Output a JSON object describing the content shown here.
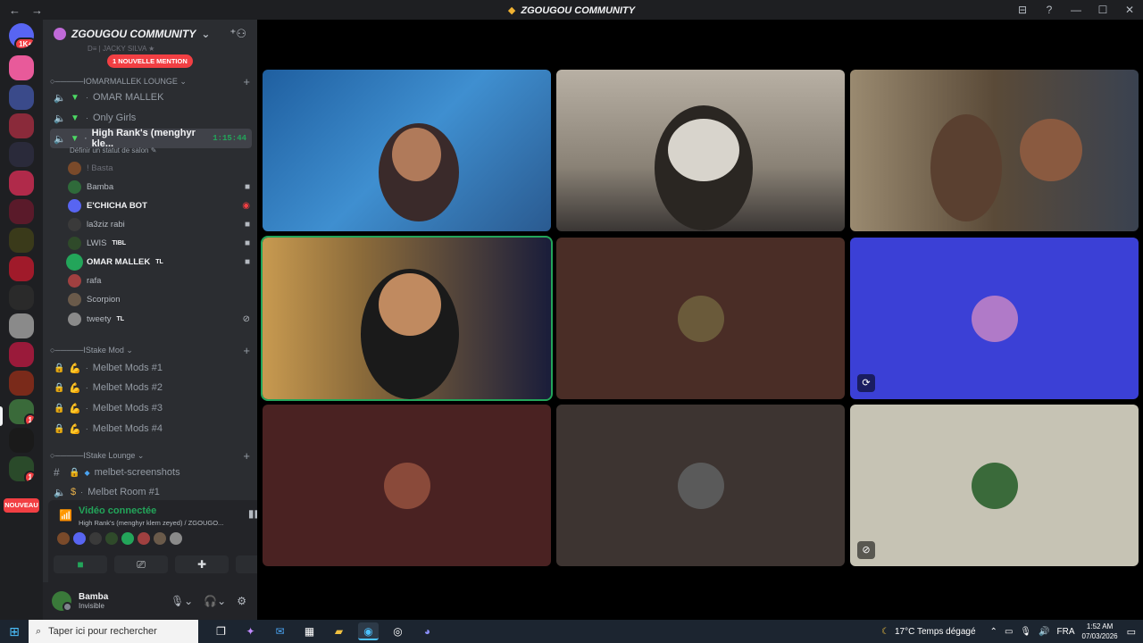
{
  "window": {
    "title": "ZGOUGOU COMMUNITY",
    "back_icon": "←",
    "forward_icon": "→",
    "controls": [
      "⊟",
      "?",
      "—",
      "☐",
      "✕"
    ]
  },
  "rail": {
    "home_badge": "1K+",
    "new_badge": "NOUVEAU",
    "server_badges": [
      "1",
      "1"
    ]
  },
  "sidebar": {
    "guild_name": "ZGOUGOU COMMUNITY",
    "dim_row": "D≡ | JACKY  SILVA ★",
    "mention_pill": "1 NOUVELLE MENTION",
    "categories": [
      {
        "label": "○─────IOMARMALLEK LOUNGE ⌄"
      },
      {
        "label": "○─────IStake Mod ⌄"
      },
      {
        "label": "○─────IStake Lounge ⌄"
      }
    ],
    "lounge_channels": [
      {
        "label": "OMAR MALLEK"
      },
      {
        "label": "Only Girls"
      },
      {
        "label": "High Rank's (menghyr kle...",
        "timer": "1:15:44"
      }
    ],
    "status_line": "Définir un statut de salon ✎",
    "voice_users": [
      {
        "name": "! Basta",
        "tag": "",
        "color": "#7a4a2a"
      },
      {
        "name": "Bamba",
        "tag": "",
        "color": "#2f6a3a"
      },
      {
        "name": "E'CHICHA BOT",
        "tag": "",
        "color": "#5865f2"
      },
      {
        "name": "la3ziz rabi",
        "tag": "",
        "color": "#3a3a3a"
      },
      {
        "name": "LWIS",
        "tag": "TIBL",
        "color": "#2f4a2a"
      },
      {
        "name": "OMAR MALLEK",
        "tag": "TL",
        "color": "#23a55a"
      },
      {
        "name": "rafa",
        "tag": "",
        "color": "#a04040"
      },
      {
        "name": "Scorpion",
        "tag": "",
        "color": "#6a5a4a"
      },
      {
        "name": "tweety",
        "tag": "TL",
        "color": "#8a8a8a"
      }
    ],
    "mod_channels": [
      {
        "label": "Melbet Mods #1"
      },
      {
        "label": "Melbet Mods #2"
      },
      {
        "label": "Melbet Mods #3"
      },
      {
        "label": "Melbet Mods #4"
      }
    ],
    "stake_channels": [
      {
        "label": "melbet-screenshots"
      },
      {
        "label": "Melbet Room #1"
      }
    ]
  },
  "voice_panel": {
    "title": "Vidéo connectée",
    "subtitle": "High Rank's (menghyr klem zeyed) / ZGOUGO...",
    "buttons": [
      "camera-button",
      "screenshare-button",
      "activities-button",
      "soundboard-button"
    ]
  },
  "user": {
    "name": "Bamba",
    "status": "Invisible"
  },
  "tiles": [
    {
      "kind": "video",
      "bg": "#3f7fc0"
    },
    {
      "kind": "video",
      "bg": "#8a8278"
    },
    {
      "kind": "video",
      "bg": "#6a5a48"
    },
    {
      "kind": "video",
      "bg": "#2a2420"
    },
    {
      "kind": "avatar",
      "bg": "#4a2d26",
      "avatar": "#6a5a3a"
    },
    {
      "kind": "avatar",
      "bg": "#3b40d6",
      "avatar": "#b07ac8"
    },
    {
      "kind": "avatar",
      "bg": "#4a2222",
      "avatar": "#8a4a3a"
    },
    {
      "kind": "avatar",
      "bg": "#3d3431",
      "avatar": "#5a5a5a"
    },
    {
      "kind": "avatar",
      "bg": "#c6c3b4",
      "avatar": "#3a6a3a"
    }
  ],
  "taskbar": {
    "search_placeholder": "Taper ici pour rechercher",
    "weather": "17°C  Temps dégagé",
    "lang": "FRA",
    "time": "1:52 AM",
    "date": "07/03/2026"
  },
  "colors": {
    "accent_green": "#23a55a",
    "mention_red": "#f23f43",
    "blurple": "#5865f2"
  }
}
